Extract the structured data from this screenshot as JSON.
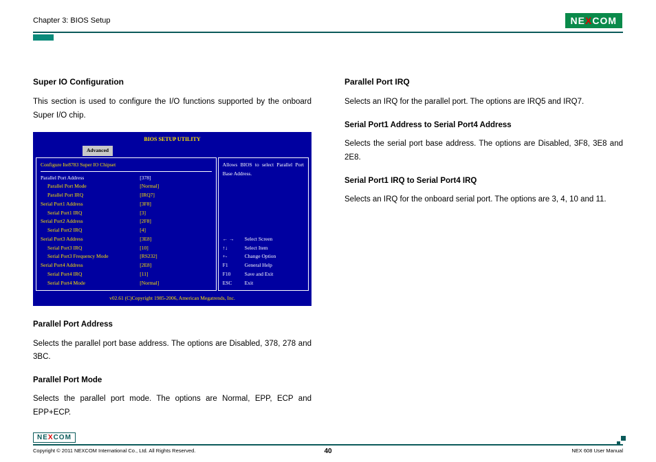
{
  "header": {
    "chapter": "Chapter 3: BIOS Setup",
    "logo_pre": "NE",
    "logo_x": "X",
    "logo_post": "COM"
  },
  "left": {
    "h_super": "Super IO Configuration",
    "p_super": "This section is used to configure the I/O functions supported by the onboard Super I/O chip.",
    "h_ppa": "Parallel Port Address",
    "p_ppa": "Selects the parallel port base address. The options are Disabled, 378, 278 and 3BC.",
    "h_ppm": "Parallel Port Mode",
    "p_ppm": "Selects the parallel port mode. The options are Normal, EPP, ECP and EPP+ECP."
  },
  "right": {
    "h_ppirq": "Parallel Port IRQ",
    "p_ppirq": "Selects an IRQ for the parallel port. The options are IRQ5 and IRQ7.",
    "h_sp_addr": "Serial Port1 Address to Serial Port4 Address",
    "p_sp_addr": "Selects the serial port base address. The options are Disabled, 3F8, 3E8 and 2E8.",
    "h_sp_irq": "Serial Port1 IRQ to Serial Port4 IRQ",
    "p_sp_irq": "Selects an IRQ for the onboard serial port. The options are 3, 4, 10 and 11."
  },
  "bios": {
    "title": "BIOS SETUP UTILITY",
    "tab": "Advanced",
    "section": "Configure Ite8783 Super IO Chipset",
    "rows": [
      {
        "k": "Parallel Port Address",
        "v": "[378]",
        "indent": false,
        "sel": true
      },
      {
        "k": "Parallel Port Mode",
        "v": "[Normal]",
        "indent": true
      },
      {
        "k": "Parallel Port IRQ",
        "v": "[IRQ7]",
        "indent": true
      },
      {
        "k": "Serial Port1 Address",
        "v": "[3F8]",
        "indent": false
      },
      {
        "k": "Serial Port1 IRQ",
        "v": "[3]",
        "indent": true
      },
      {
        "k": "Serial Port2 Address",
        "v": "[2F8]",
        "indent": false
      },
      {
        "k": "Serial Port2 IRQ",
        "v": "[4]",
        "indent": true
      },
      {
        "k": "Serial Port3 Address",
        "v": "[3E8]",
        "indent": false
      },
      {
        "k": "Serial Port3 IRQ",
        "v": "[10]",
        "indent": true
      },
      {
        "k": "Serial Port3 Frequency Mode",
        "v": "[RS232]",
        "indent": true
      },
      {
        "k": "Serial Port4 Address",
        "v": "[2E8]",
        "indent": false
      },
      {
        "k": "Serial Port4 IRQ",
        "v": "[11]",
        "indent": true
      },
      {
        "k": "Serial Port4 Mode",
        "v": "[Normal]",
        "indent": true
      }
    ],
    "help": "Allows BIOS to select Parallel Port Base Address.",
    "keys": [
      {
        "k": "← →",
        "v": "Select Screen"
      },
      {
        "k": "↑↓",
        "v": "Select Item"
      },
      {
        "k": "+-",
        "v": "Change Option"
      },
      {
        "k": "F1",
        "v": "General Help"
      },
      {
        "k": "F10",
        "v": "Save and Exit"
      },
      {
        "k": "ESC",
        "v": "Exit"
      }
    ],
    "footer": "v02.61 (C)Copyright 1985-2006, American Megatrends, Inc."
  },
  "footer": {
    "copyright": "Copyright © 2011 NEXCOM International Co., Ltd. All Rights Reserved.",
    "page": "40",
    "manual": "NEX 608 User Manual"
  }
}
